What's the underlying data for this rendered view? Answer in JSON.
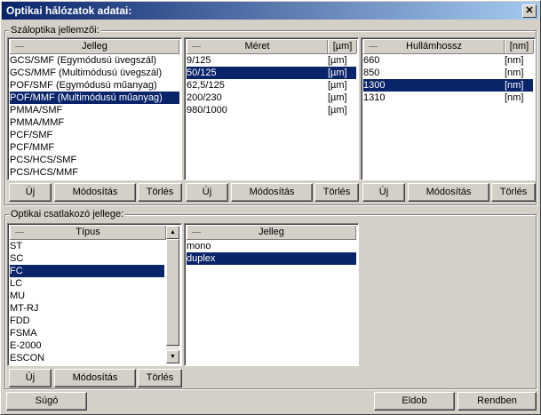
{
  "window": {
    "title": "Optikai hálózatok adatai:",
    "close_glyph": "✕"
  },
  "fiber_group": {
    "label": "Száloptika jellemzői:"
  },
  "jelleg_list": {
    "header": "Jelleg",
    "items": [
      "GCS/SMF (Egymódusú üvegszál)",
      "GCS/MMF (Multimódusú üvegszál)",
      "POF/SMF (Egymódusú műanyag)",
      "POF/MMF (Multimódusú műanyag)",
      "PMMA/SMF",
      "PMMA/MMF",
      "PCF/SMF",
      "PCF/MMF",
      "PCS/HCS/SMF",
      "PCS/HCS/MMF"
    ],
    "selected_index": 3
  },
  "meret_list": {
    "header": "Méret",
    "unit_header": "[µm]",
    "items": [
      {
        "value": "9/125",
        "unit": "[µm]"
      },
      {
        "value": "50/125",
        "unit": "[µm]"
      },
      {
        "value": "62,5/125",
        "unit": "[µm]"
      },
      {
        "value": "200/230",
        "unit": "[µm]"
      },
      {
        "value": "980/1000",
        "unit": "[µm]"
      }
    ],
    "selected_index": 1
  },
  "hullam_list": {
    "header": "Hullámhossz",
    "unit_header": "[nm]",
    "items": [
      {
        "value": "660",
        "unit": "[nm]"
      },
      {
        "value": "850",
        "unit": "[nm]"
      },
      {
        "value": "1300",
        "unit": "[nm]"
      },
      {
        "value": "1310",
        "unit": "[nm]"
      }
    ],
    "selected_index": 2
  },
  "connector_group": {
    "label": "Optikai csatlakozó jellege:"
  },
  "tipus_list": {
    "header": "Típus",
    "items": [
      "ST",
      "SC",
      "FC",
      "LC",
      "MU",
      "MT-RJ",
      "FDD",
      "FSMA",
      "E-2000",
      "ESCON"
    ],
    "selected_index": 2
  },
  "conn_jelleg_list": {
    "header": "Jelleg",
    "items": [
      "mono",
      "duplex"
    ],
    "selected_index": 1
  },
  "buttons": {
    "new": "Új",
    "modify": "Módosítás",
    "delete": "Törlés",
    "help": "Súgó",
    "discard": "Eldob",
    "ok": "Rendben"
  }
}
